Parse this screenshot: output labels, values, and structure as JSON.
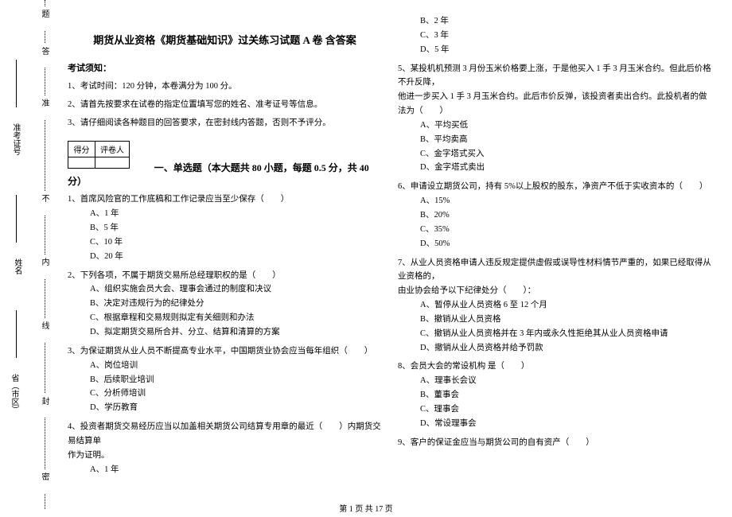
{
  "binding": {
    "seal": "密",
    "feng": "封",
    "xian": "线",
    "nei": "内",
    "bu": "不",
    "zhun": "准",
    "da": "答",
    "ti": "题"
  },
  "side_fields": {
    "province": "省（市区）",
    "name": "姓名",
    "ticket": "准考证号"
  },
  "title": "期货从业资格《期货基础知识》过关练习试题 A 卷  含答案",
  "notice_head": "考试须知：",
  "notices": [
    "1、考试时间：120 分钟，本卷满分为 100 分。",
    "2、请首先按要求在试卷的指定位置填写您的姓名、准考证号等信息。",
    "3、请仔细阅读各种题目的回答要求，在密封线内答题，否则不予评分。"
  ],
  "score_table": {
    "c1": "得分",
    "c2": "评卷人"
  },
  "section1": "一、单选题（本大题共 80 小题，每题 0.5 分，共 40 分）",
  "q1": {
    "stem": "1、首席风险官的工作底稿和工作记录应当至少保存（　　）",
    "a": "A、1 年",
    "b": "B、5 年",
    "c": "C、10 年",
    "d": "D、20 年"
  },
  "q2": {
    "stem": "2、下列各项，不属于期货交易所总经理职权的是（　　）",
    "a": "A、组织实施会员大会、理事会通过的制度和决议",
    "b": "B、决定对违规行为的纪律处分",
    "c": "C、根据章程和交易规则拟定有关细则和办法",
    "d": "D、拟定期货交易所合并、分立、结算和清算的方案"
  },
  "q3": {
    "stem": "3、为保证期货从业人员不断提高专业水平，中国期货业协会应当每年组织（　　）",
    "a": "A、岗位培训",
    "b": "B、后续职业培训",
    "c": "C、分析师培训",
    "d": "D、学历教育"
  },
  "q4": {
    "stem_a": "4、投资者期货交易经历应当以加盖相关期货公司结算专用章的最近（　　）内期货交易结算单",
    "stem_b": "作为证明。",
    "a": "A、1 年",
    "b": "B、2 年",
    "c": "C、3 年",
    "d": "D、5 年"
  },
  "q5": {
    "stem_a": "5、某投机机预测 3 月份玉米价格要上涨，于是他买入 1 手 3 月玉米合约。但此后价格不升反降，",
    "stem_b": "他进一步买入 1 手 3 月玉米合约。此后市价反弹，该投资者卖出合约。此投机者的做法为（　　）",
    "a": "A、平均买低",
    "b": "B、平均卖高",
    "c": "C、金字塔式买入",
    "d": "D、金字塔式卖出"
  },
  "q6": {
    "stem": "6、申请设立期货公司，持有 5%以上股权的股东，净资产不低于实收资本的（　　）",
    "a": "A、15%",
    "b": "B、20%",
    "c": "C、35%",
    "d": "D、50%"
  },
  "q7": {
    "stem_a": "7、从业人员资格申请人违反规定提供虚假或误导性材料情节严重的，如果已经取得从业资格的，",
    "stem_b": "由业协会给予以下纪律处分（　　）：",
    "a": "A、暂停从业人员资格 6 至 12 个月",
    "b": "B、撤销从业人员资格",
    "c": "C、撤销从业人员资格并在 3 年内或永久性拒绝其从业人员资格申请",
    "d": "D、撤销从业人员资格并给予罚款"
  },
  "q8": {
    "stem": "8、会员大会的常设机构 是（　　）",
    "a": "A、理事长会议",
    "b": "B、董事会",
    "c": "C、理事会",
    "d": "D、常设理事会"
  },
  "q9": {
    "stem": "9、客户的保证金应当与期货公司的自有资产（　　）"
  },
  "footer": "第 1 页 共 17 页"
}
